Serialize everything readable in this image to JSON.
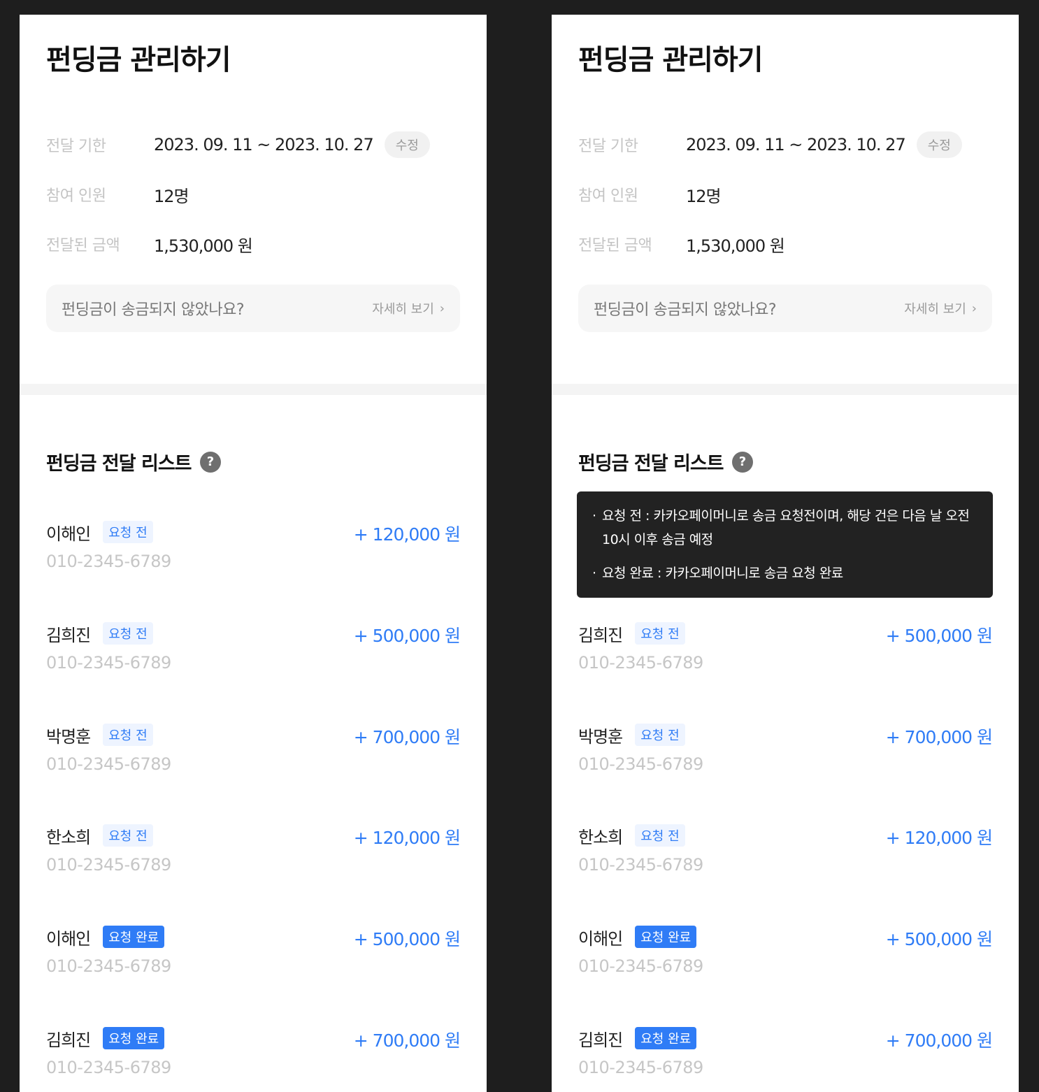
{
  "panels": [
    {
      "title": "펀딩금 관리하기",
      "info": {
        "period_label": "전달 기한",
        "period_value": "2023. 09. 11 ~ 2023. 10. 27",
        "edit_label": "수정",
        "participants_label": "참여 인원",
        "participants_value": "12명",
        "amount_label": "전달된 금액",
        "amount_value": "1,530,000 원"
      },
      "notice": {
        "question": "펀딩금이 송금되지 않았나요?",
        "more_label": "자세히 보기",
        "more_icon": "›"
      },
      "list_title": "펀딩금 전달 리스트",
      "help_icon": "?",
      "items": [
        {
          "name": "이해인",
          "status": "요청 전",
          "phone": "010-2345-6789",
          "amount": "+ 120,000 원"
        },
        {
          "name": "김희진",
          "status": "요청 전",
          "phone": "010-2345-6789",
          "amount": "+ 500,000 원"
        },
        {
          "name": "박명훈",
          "status": "요청 전",
          "phone": "010-2345-6789",
          "amount": "+ 700,000 원"
        },
        {
          "name": "한소희",
          "status": "요청 전",
          "phone": "010-2345-6789",
          "amount": "+ 120,000 원"
        },
        {
          "name": "이해인",
          "status": "요청 완료",
          "phone": "010-2345-6789",
          "amount": "+ 500,000 원"
        },
        {
          "name": "김희진",
          "status": "요청 완료",
          "phone": "010-2345-6789",
          "amount": "+ 700,000 원"
        }
      ]
    },
    {
      "title": "펀딩금 관리하기",
      "info": {
        "period_label": "전달 기한",
        "period_value": "2023. 09. 11 ~ 2023. 10. 27",
        "edit_label": "수정",
        "participants_label": "참여 인원",
        "participants_value": "12명",
        "amount_label": "전달된 금액",
        "amount_value": "1,530,000 원"
      },
      "notice": {
        "question": "펀딩금이 송금되지 않았나요?",
        "more_label": "자세히 보기",
        "more_icon": "›"
      },
      "list_title": "펀딩금 전달 리스트",
      "help_icon": "?",
      "tooltip": {
        "bullet": "·",
        "line1": "요청 전 : 카카오페이머니로 송금 요청전이며, 해당 건은 다음 날 오전 10시 이후 송금 예정",
        "line2": "요청 완료 : 카카오페이머니로 송금 요청 완료"
      },
      "items": [
        {
          "name": "김희진",
          "status": "요청 전",
          "phone": "010-2345-6789",
          "amount": "+ 500,000 원"
        },
        {
          "name": "박명훈",
          "status": "요청 전",
          "phone": "010-2345-6789",
          "amount": "+ 700,000 원"
        },
        {
          "name": "한소희",
          "status": "요청 전",
          "phone": "010-2345-6789",
          "amount": "+ 120,000 원"
        },
        {
          "name": "이해인",
          "status": "요청 완료",
          "phone": "010-2345-6789",
          "amount": "+ 500,000 원"
        },
        {
          "name": "김희진",
          "status": "요청 완료",
          "phone": "010-2345-6789",
          "amount": "+ 700,000 원"
        }
      ]
    }
  ]
}
